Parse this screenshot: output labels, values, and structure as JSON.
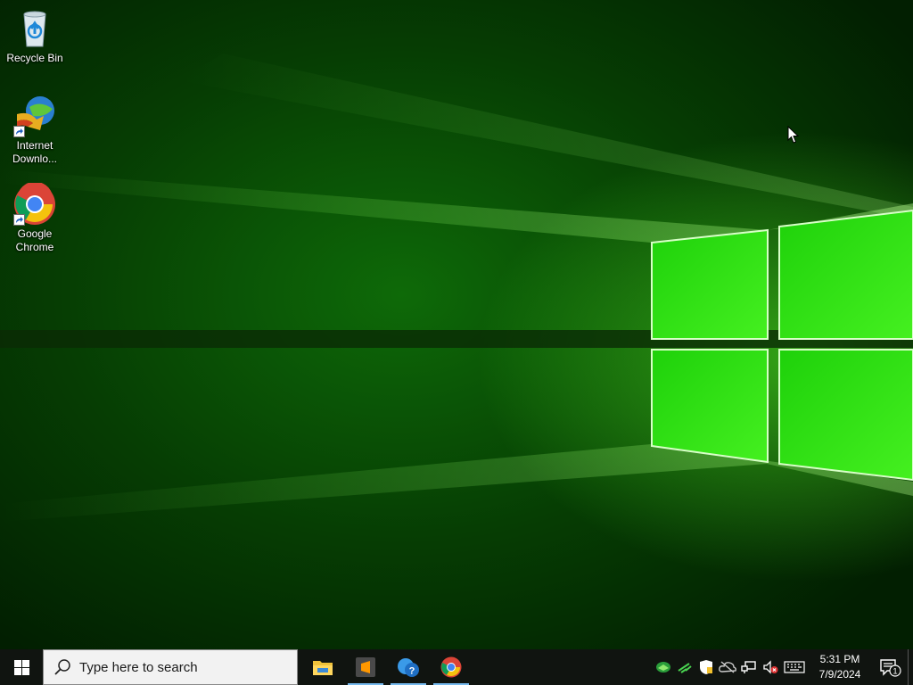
{
  "desktop": {
    "icons": [
      {
        "label": "Recycle Bin",
        "icon": "recycle-bin-icon"
      },
      {
        "label": "Internet Downlo...",
        "icon": "internet-download-manager-icon"
      },
      {
        "label": "Google Chrome",
        "icon": "google-chrome-icon"
      }
    ]
  },
  "taskbar": {
    "start_icon": "windows-logo-icon",
    "search": {
      "placeholder": "Type here to search",
      "icon": "search-icon"
    },
    "pinned": [
      {
        "name": "File Explorer",
        "icon": "folder-icon"
      },
      {
        "name": "Sublime Text",
        "icon": "sublime-text-icon"
      },
      {
        "name": "Get Help",
        "icon": "help-icon"
      },
      {
        "name": "Google Chrome",
        "icon": "google-chrome-icon"
      }
    ],
    "tray": {
      "icons": [
        "idm-tray-icon",
        "network-activity-icon",
        "security-shield-icon",
        "onedrive-offline-icon",
        "network-icon",
        "volume-muted-icon",
        "keyboard-icon"
      ],
      "time": "5:31 PM",
      "date": "7/9/2024",
      "notification_count": "1"
    },
    "accent_color": "#76b9ed"
  },
  "colors": {
    "wallpaper_glow": "#5aff28",
    "wallpaper_dark": "#063d03",
    "taskbar": "#101410"
  }
}
